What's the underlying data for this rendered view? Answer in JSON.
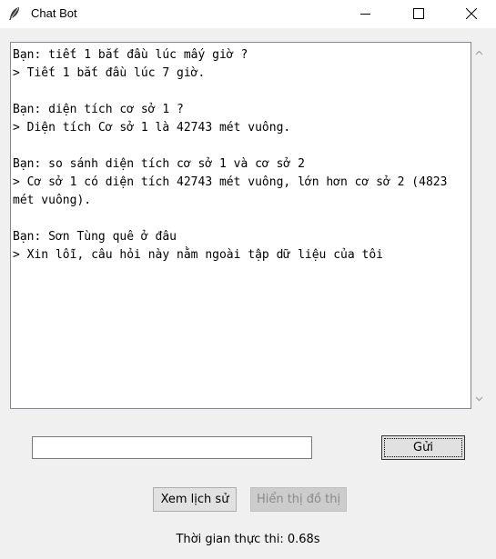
{
  "window": {
    "title": "Chat Bot",
    "app_icon": "feather-icon"
  },
  "chat": {
    "lines": [
      "Bạn: tiết 1 bắt đầu lúc mấy giờ ?",
      "> Tiết 1 bắt đầu lúc 7 giờ.",
      "",
      "Bạn: diện tích cơ sở 1 ?",
      "> Diện tích Cơ sở 1 là 42743 mét vuông.",
      "",
      "Bạn: so sánh diện tích cơ sở 1 và cơ sở 2",
      "> Cơ sở 1 có diện tích 42743 mét vuông, lớn hơn cơ sở 2 (4823 mét vuông).",
      "",
      "Bạn: Sơn Tùng quê ở đâu",
      "> Xin lỗi, câu hỏi này nằm ngoài tập dữ liệu của tôi"
    ]
  },
  "input": {
    "value": "",
    "placeholder": ""
  },
  "buttons": {
    "send_label": "Gửi",
    "history_label": "Xem lịch sử",
    "graph_label": "Hiển thị đồ thị"
  },
  "status": {
    "exec_time": "Thời gian thực thi: 0.68s"
  },
  "colors": {
    "background": "#f0f0f0",
    "disabled_button": "#cccccc",
    "disabled_text": "#8a8a8a"
  }
}
